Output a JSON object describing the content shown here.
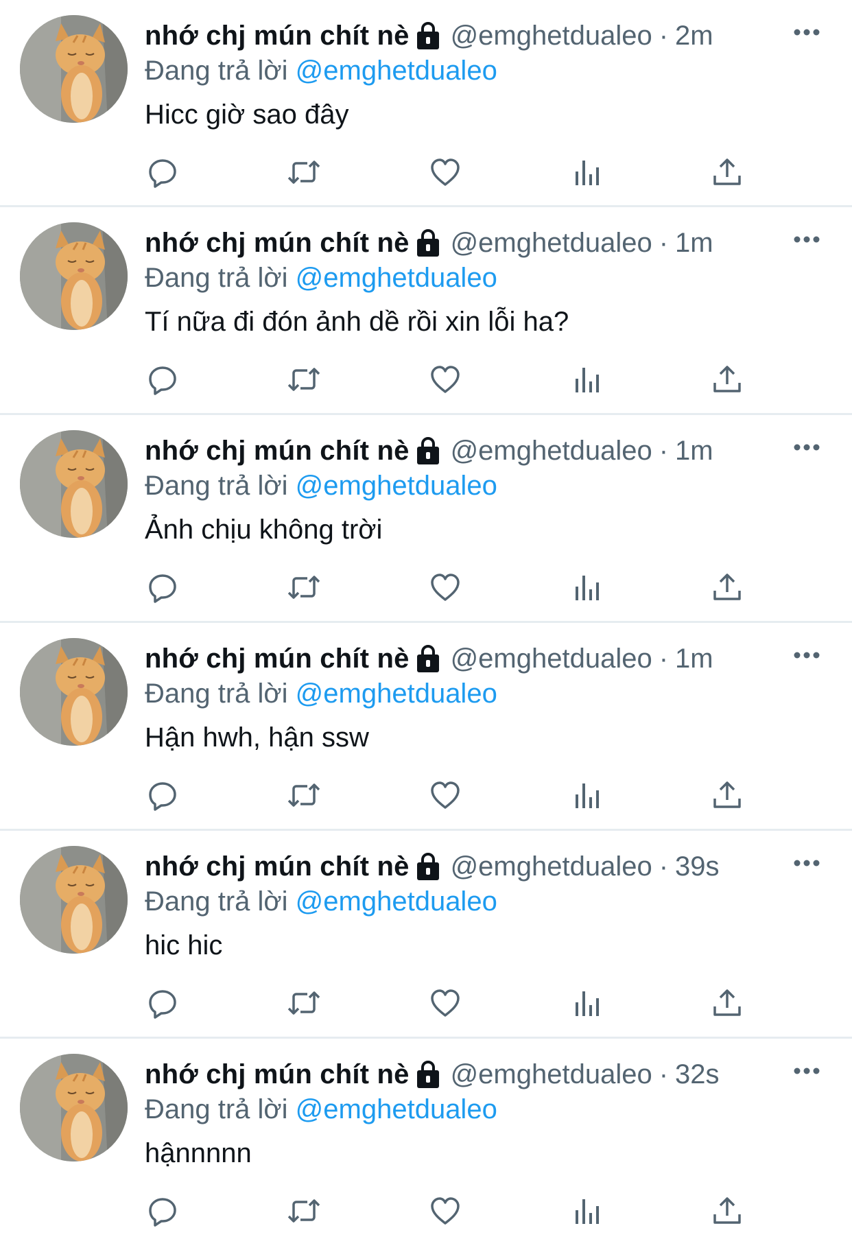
{
  "colors": {
    "text": "#0f1419",
    "secondary": "#536471",
    "link": "#1d9bf0",
    "divider": "#e6ecf0"
  },
  "tweets": [
    {
      "display_name": "nhớ chj mún chít nè",
      "handle": "@emghetdualeo",
      "separator": "·",
      "time": "2m",
      "reply_prefix": "Đang trả lời",
      "reply_to": "@emghetdualeo",
      "text": "Hicc giờ sao đây"
    },
    {
      "display_name": "nhớ chj mún chít nè",
      "handle": "@emghetdualeo",
      "separator": "·",
      "time": "1m",
      "reply_prefix": "Đang trả lời",
      "reply_to": "@emghetdualeo",
      "text": "Tí nữa đi đón ảnh dề rồi xin lỗi ha?"
    },
    {
      "display_name": "nhớ chj mún chít nè",
      "handle": "@emghetdualeo",
      "separator": "·",
      "time": "1m",
      "reply_prefix": "Đang trả lời",
      "reply_to": "@emghetdualeo",
      "text": "Ảnh chịu không trời"
    },
    {
      "display_name": "nhớ chj mún chít nè",
      "handle": "@emghetdualeo",
      "separator": "·",
      "time": "1m",
      "reply_prefix": "Đang trả lời",
      "reply_to": "@emghetdualeo",
      "text": "Hận hwh, hận ssw"
    },
    {
      "display_name": "nhớ chj mún chít nè",
      "handle": "@emghetdualeo",
      "separator": "·",
      "time": "39s",
      "reply_prefix": "Đang trả lời",
      "reply_to": "@emghetdualeo",
      "text": "hic hic"
    },
    {
      "display_name": "nhớ chj mún chít nè",
      "handle": "@emghetdualeo",
      "separator": "·",
      "time": "32s",
      "reply_prefix": "Đang trả lời",
      "reply_to": "@emghetdualeo",
      "text": "hậnnnnn"
    }
  ],
  "icons": {
    "avatar": "cat-avatar",
    "lock": "lock-icon",
    "more": "more-icon",
    "reply": "reply-icon",
    "retweet": "retweet-icon",
    "like": "heart-icon",
    "views": "views-icon",
    "share": "share-icon"
  }
}
